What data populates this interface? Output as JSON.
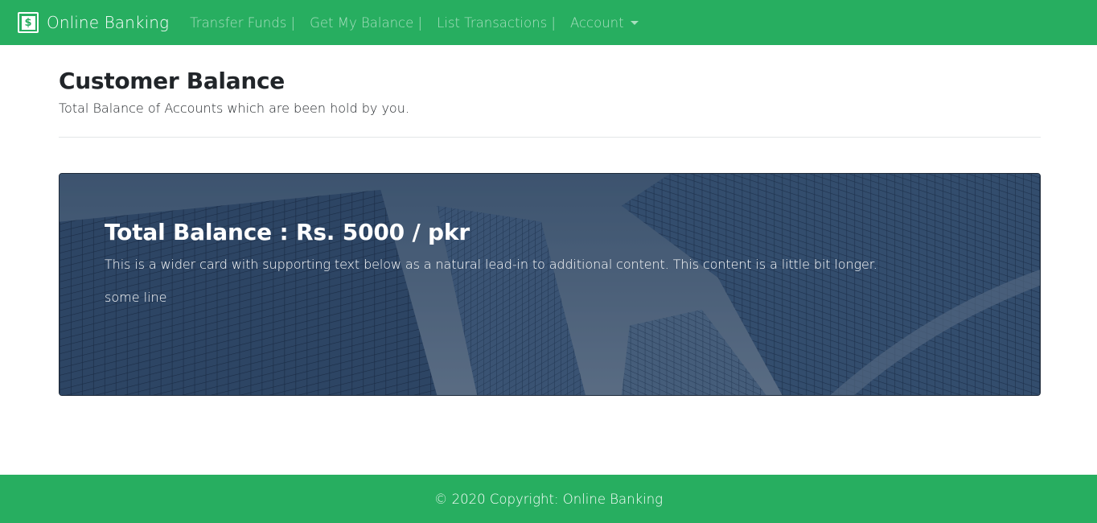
{
  "navbar": {
    "brand": {
      "icon": "dollar-bill-icon",
      "icon_glyph": "$",
      "label": "Online Banking"
    },
    "links": [
      {
        "label": "Transfer Funds |"
      },
      {
        "label": "Get My Balance |"
      },
      {
        "label": "List Transactions |"
      }
    ],
    "account_dropdown": {
      "label": "Account"
    },
    "background_color": "#27ae60"
  },
  "header": {
    "title": "Customer Balance",
    "subtitle": "Total Balance of Accounts which are been hold by you."
  },
  "balance_card": {
    "title": "Total Balance : Rs. 5000 / pkr",
    "text": "This is a wider card with supporting text below as a natural lead-in to additional content. This content is a little bit longer.",
    "line": "some line",
    "background": "skyscrapers-image"
  },
  "footer": {
    "copyright": "© 2020 Copyright: Online Banking",
    "background_color": "#27ae60"
  }
}
